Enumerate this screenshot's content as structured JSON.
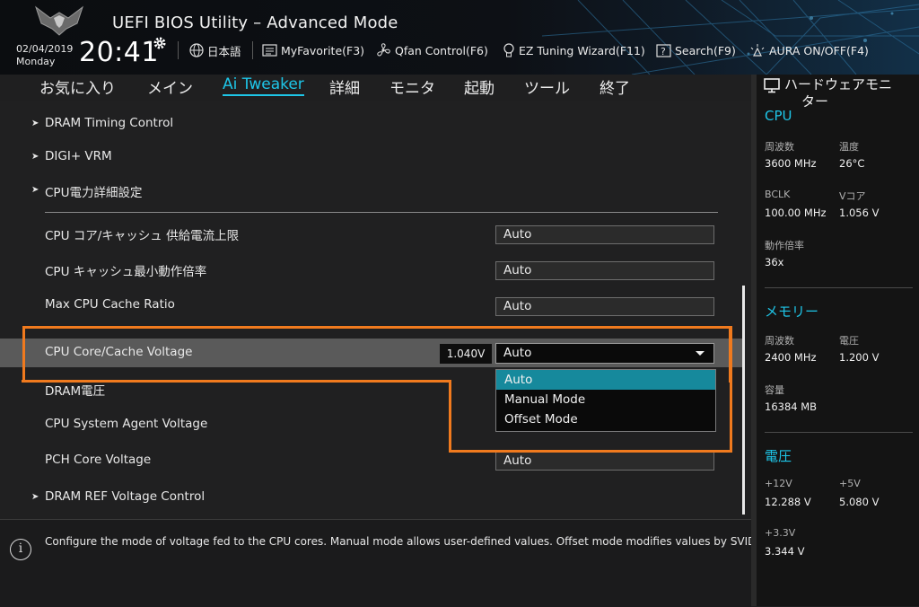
{
  "header": {
    "title": "UEFI BIOS Utility – Advanced Mode",
    "date": "02/04/2019",
    "day": "Monday",
    "time": "20:41",
    "language": "日本語",
    "my_favorite": "MyFavorite(F3)",
    "qfan": "Qfan Control(F6)",
    "ez_tuning": "EZ Tuning Wizard(F11)",
    "search": "Search(F9)",
    "aura": "AURA ON/OFF(F4)"
  },
  "tabs": [
    "お気に入り",
    "メイン",
    "Ai Tweaker",
    "詳細",
    "モニタ",
    "起動",
    "ツール",
    "終了"
  ],
  "active_tab": "Ai Tweaker",
  "settings": {
    "dram_timing": "DRAM Timing Control",
    "digi_vrm": "DIGI+ VRM",
    "cpu_power": "CPU電力詳細設定",
    "cpu_current_limit": {
      "label": "CPU コア/キャッシュ 供給電流上限",
      "value": "Auto"
    },
    "cpu_cache_min_ratio": {
      "label": "CPU キャッシュ最小動作倍率",
      "value": "Auto"
    },
    "max_cpu_cache_ratio": {
      "label": "Max CPU Cache Ratio",
      "value": "Auto"
    },
    "cpu_core_voltage": {
      "label": "CPU Core/Cache Voltage",
      "current": "1.040V",
      "value": "Auto"
    },
    "dram_voltage": {
      "label": "DRAM電圧"
    },
    "cpu_sa_voltage": {
      "label": "CPU System Agent Voltage"
    },
    "pch_core_voltage": {
      "label": "PCH Core Voltage",
      "value": "Auto"
    },
    "dram_ref_voltage": "DRAM REF Voltage Control"
  },
  "dropdown": {
    "options": [
      "Auto",
      "Manual Mode",
      "Offset Mode"
    ],
    "selected": "Auto"
  },
  "help": {
    "text": "Configure the mode of voltage fed to the CPU cores. Manual mode allows user-defined values. Offset mode modifies values by SVID."
  },
  "hardware_monitor": {
    "title_line1": "ハードウェアモニ",
    "title_line2": "ター",
    "cpu": {
      "heading": "CPU",
      "freq_label": "周波数",
      "freq_value": "3600 MHz",
      "temp_label": "温度",
      "temp_value": "26°C",
      "bclk_label": "BCLK",
      "bclk_value": "100.00 MHz",
      "vcore_label": "Vコア",
      "vcore_value": "1.056 V",
      "ratio_label": "動作倍率",
      "ratio_value": "36x"
    },
    "memory": {
      "heading": "メモリー",
      "freq_label": "周波数",
      "freq_value": "2400 MHz",
      "volt_label": "電圧",
      "volt_value": "1.200 V",
      "cap_label": "容量",
      "cap_value": "16384 MB"
    },
    "voltage": {
      "heading": "電圧",
      "v12_label": "+12V",
      "v12_value": "12.288 V",
      "v5_label": "+5V",
      "v5_value": "5.080 V",
      "v33_label": "+3.3V",
      "v33_value": "3.344 V"
    }
  },
  "colors": {
    "accent": "#1ec6e8",
    "highlight_box": "#f07a1e",
    "selected_option": "#16899c"
  }
}
